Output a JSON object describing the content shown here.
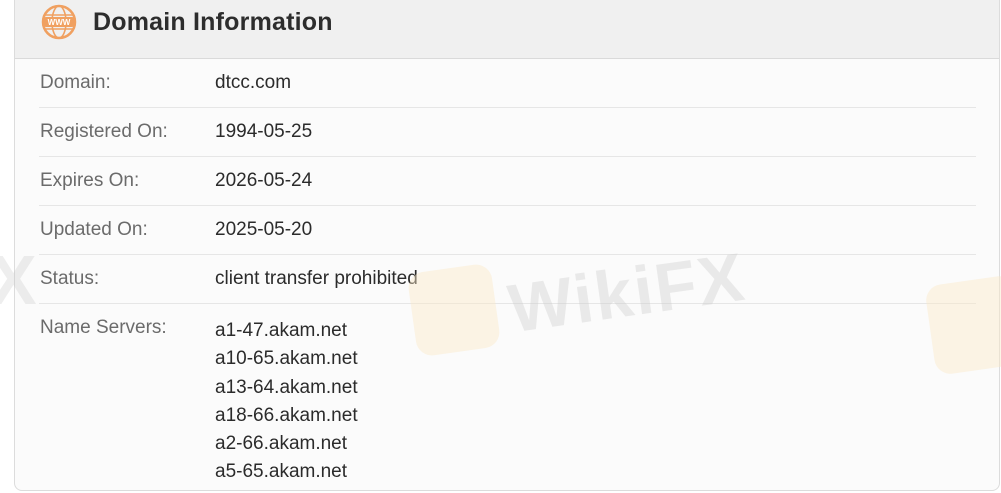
{
  "header": {
    "icon": "www-globe-icon",
    "title": "Domain Information",
    "accent_color": "#f0a060"
  },
  "rows": [
    {
      "label": "Domain:",
      "value": "dtcc.com"
    },
    {
      "label": "Registered On:",
      "value": "1994-05-25"
    },
    {
      "label": "Expires On:",
      "value": "2026-05-24"
    },
    {
      "label": "Updated On:",
      "value": "2025-05-20"
    },
    {
      "label": "Status:",
      "value": "client transfer prohibited"
    }
  ],
  "name_servers": {
    "label": "Name Servers:",
    "values": [
      "a1-47.akam.net",
      "a10-65.akam.net",
      "a13-64.akam.net",
      "a18-66.akam.net",
      "a2-66.akam.net",
      "a5-65.akam.net"
    ]
  },
  "watermark": {
    "text": "WikiFX",
    "left_fragment": "X"
  }
}
